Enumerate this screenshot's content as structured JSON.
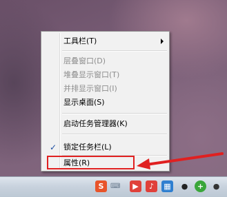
{
  "context_menu": {
    "items": [
      {
        "label": "工具栏(T)",
        "enabled": true,
        "submenu": true
      },
      {
        "label": "层叠窗口(D)",
        "enabled": false
      },
      {
        "label": "堆叠显示窗口(T)",
        "enabled": false
      },
      {
        "label": "并排显示窗口(I)",
        "enabled": false
      },
      {
        "label": "显示桌面(S)",
        "enabled": true
      },
      {
        "label": "启动任务管理器(K)",
        "enabled": true
      },
      {
        "label": "锁定任务栏(L)",
        "enabled": true,
        "checked": true
      },
      {
        "label": "属性(R)",
        "enabled": true
      }
    ],
    "check_glyph": "✓"
  },
  "annotation": {
    "highlight_color": "#e02020"
  },
  "tray": {
    "icons": [
      {
        "name": "sogou-input-icon",
        "glyph": "S",
        "color": "#e8542a"
      },
      {
        "name": "keyboard-icon",
        "glyph": "⌨",
        "color": "#6b7c8f"
      },
      {
        "name": "media-player-icon",
        "glyph": "▶",
        "color": "#e0413a"
      },
      {
        "name": "audio-icon",
        "glyph": "♪",
        "color": "#e0403a"
      },
      {
        "name": "network-grid-icon",
        "glyph": "▦",
        "color": "#2f7fd0"
      },
      {
        "name": "penguin-icon",
        "glyph": "●",
        "color": "#222222"
      },
      {
        "name": "add-green-icon",
        "glyph": "+",
        "color": "#3aa63a"
      },
      {
        "name": "qq-icon",
        "glyph": "●",
        "color": "#333333"
      }
    ]
  }
}
